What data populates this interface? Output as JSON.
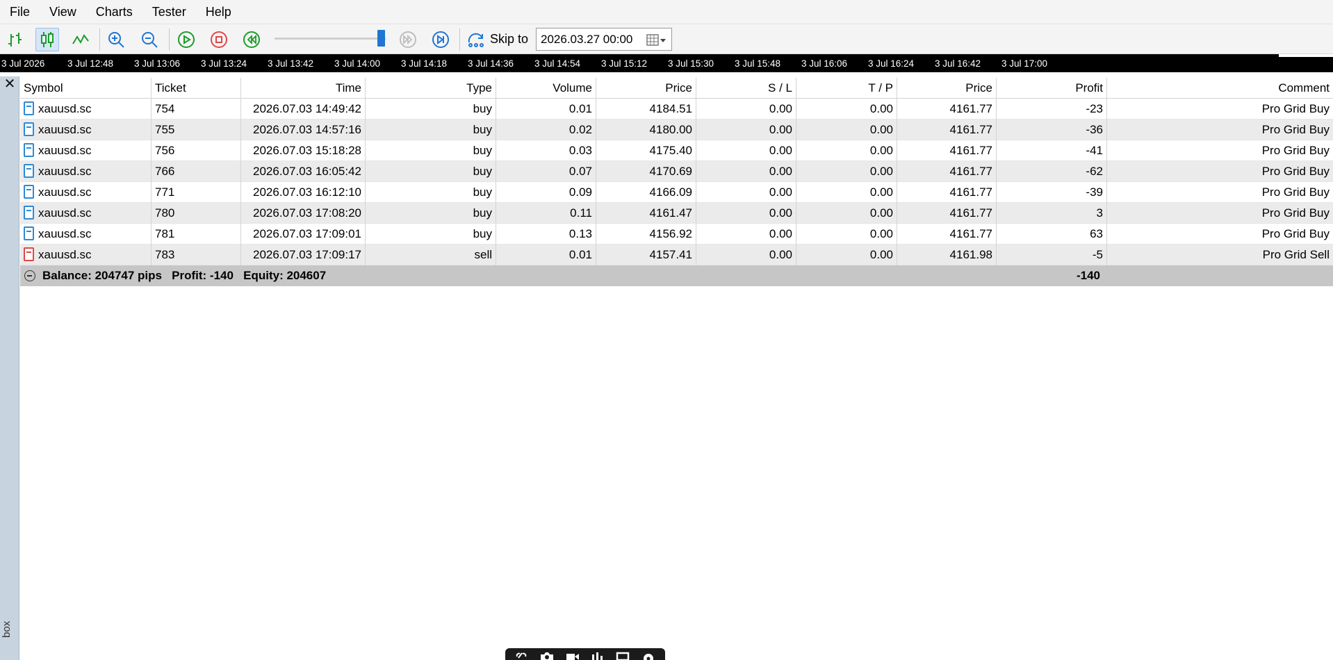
{
  "menu": [
    "File",
    "View",
    "Charts",
    "Tester",
    "Help"
  ],
  "toolbar": {
    "buttons": [
      "bar-chart-icon",
      "candlestick-icon",
      "line-chart-icon",
      "zoom-in-icon",
      "zoom-out-icon",
      "play-icon",
      "stop-icon",
      "rewind-icon",
      "fast-forward-icon",
      "skip-end-icon",
      "skip-to-icon",
      "calendar-icon"
    ],
    "skip_label": "Skip to",
    "skip_date": "2026.03.27 00:00"
  },
  "timescale": [
    "3 Jul 2026",
    "3 Jul 12:48",
    "3 Jul 13:06",
    "3 Jul 13:24",
    "3 Jul 13:42",
    "3 Jul 14:00",
    "3 Jul 14:18",
    "3 Jul 14:36",
    "3 Jul 14:54",
    "3 Jul 15:12",
    "3 Jul 15:30",
    "3 Jul 15:48",
    "3 Jul 16:06",
    "3 Jul 16:24",
    "3 Jul 16:42",
    "3 Jul 17:00"
  ],
  "panel": {
    "close": "✕",
    "side_label": "box"
  },
  "table": {
    "columns": [
      "Symbol",
      "Ticket",
      "Time",
      "Type",
      "Volume",
      "Price",
      "S / L",
      "T / P",
      "Price",
      "Profit",
      "Comment"
    ],
    "rows": [
      [
        "xauusd.sc",
        "754",
        "2026.07.03 14:49:42",
        "buy",
        "0.01",
        "4184.51",
        "0.00",
        "0.00",
        "4161.77",
        "-23",
        "Pro Grid Buy"
      ],
      [
        "xauusd.sc",
        "755",
        "2026.07.03 14:57:16",
        "buy",
        "0.02",
        "4180.00",
        "0.00",
        "0.00",
        "4161.77",
        "-36",
        "Pro Grid Buy"
      ],
      [
        "xauusd.sc",
        "756",
        "2026.07.03 15:18:28",
        "buy",
        "0.03",
        "4175.40",
        "0.00",
        "0.00",
        "4161.77",
        "-41",
        "Pro Grid Buy"
      ],
      [
        "xauusd.sc",
        "766",
        "2026.07.03 16:05:42",
        "buy",
        "0.07",
        "4170.69",
        "0.00",
        "0.00",
        "4161.77",
        "-62",
        "Pro Grid Buy"
      ],
      [
        "xauusd.sc",
        "771",
        "2026.07.03 16:12:10",
        "buy",
        "0.09",
        "4166.09",
        "0.00",
        "0.00",
        "4161.77",
        "-39",
        "Pro Grid Buy"
      ],
      [
        "xauusd.sc",
        "780",
        "2026.07.03 17:08:20",
        "buy",
        "0.11",
        "4161.47",
        "0.00",
        "0.00",
        "4161.77",
        "3",
        "Pro Grid Buy"
      ],
      [
        "xauusd.sc",
        "781",
        "2026.07.03 17:09:01",
        "buy",
        "0.13",
        "4156.92",
        "0.00",
        "0.00",
        "4161.77",
        "63",
        "Pro Grid Buy"
      ],
      [
        "xauusd.sc",
        "783",
        "2026.07.03 17:09:17",
        "sell",
        "0.01",
        "4157.41",
        "0.00",
        "0.00",
        "4161.98",
        "-5",
        "Pro Grid Sell"
      ]
    ],
    "summary": {
      "text": "Balance: 204747 pips   Profit: -140   Equity: 204607",
      "total_profit": "-140"
    }
  },
  "floatbar": [
    "link-icon",
    "camera-icon",
    "video-icon",
    "chart-icon",
    "window-icon",
    "gear-icon"
  ]
}
